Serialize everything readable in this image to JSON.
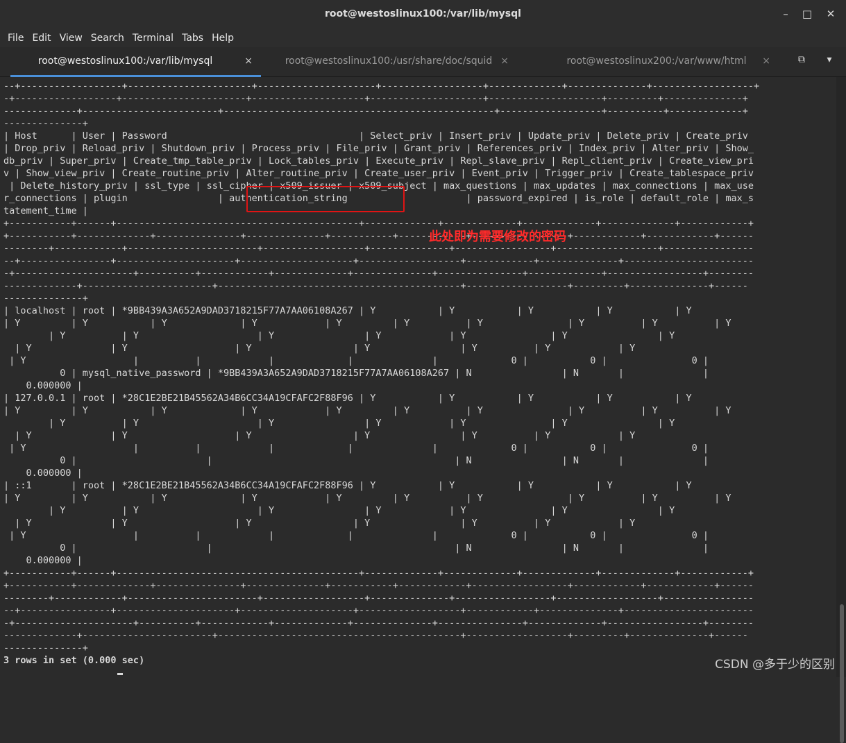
{
  "window": {
    "title": "root@westoslinux100:/var/lib/mysql",
    "minimize": "–",
    "maximize": "□",
    "close": "✕"
  },
  "menu": [
    "File",
    "Edit",
    "View",
    "Search",
    "Terminal",
    "Tabs",
    "Help"
  ],
  "tabs": [
    {
      "label": "root@westoslinux100:/var/lib/mysql",
      "close": "×",
      "active": true
    },
    {
      "label": "root@westoslinux100:/usr/share/doc/squid",
      "close": "×",
      "active": false
    },
    {
      "label": "root@westoslinux200:/var/www/html",
      "close": "×",
      "active": false
    }
  ],
  "tab_actions": {
    "new_tab": "⧉",
    "dropdown": "▾"
  },
  "terminal": {
    "lines": [
      "--+------------------+----------------------+---------------------+------------------+-------------+--------------+------------------+",
      "-+------------------+----------------------+--------------------+--------------------+--------------------+---------+--------------+",
      "-------------+------------------------+------------------------------------------------+------------------+----------+-------------+",
      "--------------+",
      "| Host      | User | Password                                  | Select_priv | Insert_priv | Update_priv | Delete_priv | Create_priv",
      "| Drop_priv | Reload_priv | Shutdown_priv | Process_priv | File_priv | Grant_priv | References_priv | Index_priv | Alter_priv | Show_",
      "db_priv | Super_priv | Create_tmp_table_priv | Lock_tables_priv | Execute_priv | Repl_slave_priv | Repl_client_priv | Create_view_pri",
      "v | Show_view_priv | Create_routine_priv | Alter_routine_priv | Create_user_priv | Event_priv | Trigger_priv | Create_tablespace_priv",
      " | Delete_history_priv | ssl_type | ssl_cipher | x509_issuer | x509_subject | max_questions | max_updates | max_connections | max_use",
      "r_connections | plugin                | authentication_string                     | password_expired | is_role | default_role | max_s",
      "tatement_time |",
      "+-----------+------+-------------------------------------------+-------------+-------------+-------------+-------------+------------+",
      "+-----------+-------------+---------------+--------------+-----------+------------+-----------------+------------+------------+------",
      "--------+------------+-----------------------+------------------+--------------+-----------------+------------------+----------------",
      "--+----------------+---------------------+--------------------+------------------+------------+--------------+-----------------------",
      "-+---------------------+----------+------------+-------------+--------------+---------------+-------------+-----------------+--------",
      "-------------+-----------------------+-------------------------------------------+------------------+---------+--------------+------",
      "--------------+",
      "| localhost | root | *9BB439A3A652A9DAD3718215F77A7AA06108A267 | Y           | Y           | Y           | Y           | Y",
      "| Y         | Y           | Y             | Y            | Y         | Y          | Y               | Y          | Y          | Y",
      "        | Y          | Y                     | Y                | Y            | Y               | Y                | Y",
      "  | Y              | Y                   | Y                  | Y                | Y          | Y            | Y",
      " | Y                   |          |            |             |              |             0 |           0 |               0 |",
      "          0 | mysql_native_password | *9BB439A3A652A9DAD3718215F77A7AA06108A267 | N                | N       |              |",
      "    0.000000 |",
      "| 127.0.0.1 | root | *28C1E2BE21B45562A34B6CC34A19CFAFC2F88F96 | Y           | Y           | Y           | Y           | Y",
      "| Y         | Y           | Y             | Y            | Y         | Y          | Y               | Y          | Y          | Y",
      "        | Y          | Y                     | Y                | Y            | Y               | Y                | Y",
      "  | Y              | Y                   | Y                  | Y                | Y          | Y            | Y",
      " | Y                   |          |            |             |              |             0 |           0 |               0 |",
      "          0 |                       |                                           | N                | N       |              |",
      "    0.000000 |",
      "| ::1       | root | *28C1E2BE21B45562A34B6CC34A19CFAFC2F88F96 | Y           | Y           | Y           | Y           | Y",
      "| Y         | Y           | Y             | Y            | Y         | Y          | Y               | Y          | Y          | Y",
      "        | Y          | Y                     | Y                | Y            | Y               | Y                | Y",
      "  | Y              | Y                   | Y                  | Y                | Y          | Y            | Y",
      " | Y                   |          |            |             |              |             0 |           0 |               0 |",
      "          0 |                       |                                           | N                | N       |              |",
      "    0.000000 |",
      "+-----------+------+-------------------------------------------+-------------+-------------+-------------+-------------+------------+",
      "+-----------+-------------+---------------+--------------+-----------+------------+-----------------+------------+------------+------",
      "--------+------------+-----------------------+------------------+--------------+-----------------+------------------+----------------",
      "--+----------------+---------------------+--------------------+------------------+------------+--------------+-----------------------",
      "-+---------------------+----------+------------+-------------+--------------+---------------+-------------+-----------------+--------",
      "-------------+-----------------------+-------------------------------------------+------------------+---------+--------------+------",
      "--------------+",
      "3 rows in set (0.000 sec)"
    ]
  },
  "annotation": {
    "text": "此处即为需要修改的密码",
    "color": "#ff2a2a"
  },
  "watermark": "CSDN @多于少的区别",
  "colors": {
    "background": "#2b2b2b",
    "foreground": "#d8d8d8",
    "accent": "#4a90d9",
    "highlight": "#e01414"
  }
}
